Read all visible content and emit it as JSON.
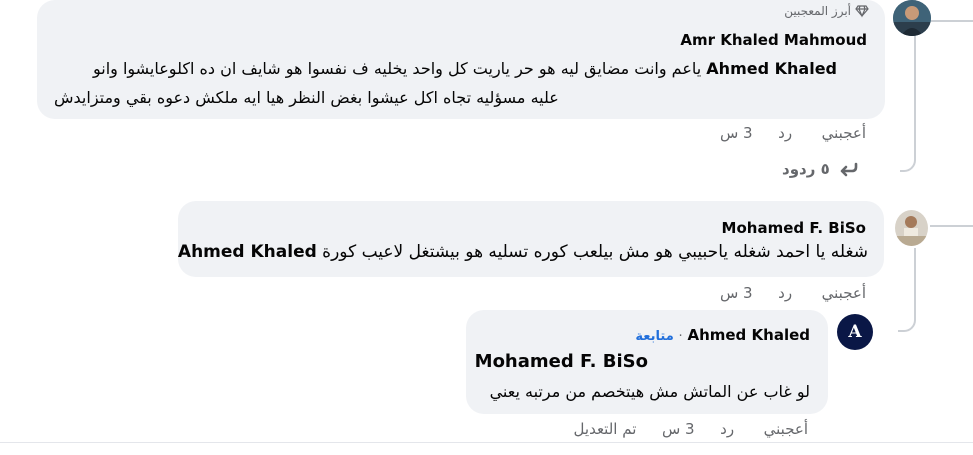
{
  "comments": [
    {
      "badge": "أبرز المعجبين",
      "author": "Amr Khaled Mahmoud",
      "mention": "Ahmed Khaled",
      "text_line1": " ياعم وانت مضايق ليه هو حر ياريت كل واحد يخليه ف نفسوا هو شايف ان ده اكلوعايشوا وانو",
      "text_line2": "عليه مسؤليه تجاه اكل عيشوا بغض النظر هيا ايه ملكش دعوه بقي ومتزايدش",
      "like": "أعجبني",
      "reply": "رد",
      "time": "3 س",
      "replies_label": "٥ ردود"
    },
    {
      "author": "Mohamed F. BiSo",
      "text": "شغله يا احمد شغله ياحبيبي هو مش بيلعب كوره تسليه هو بيشتغل لاعيب كورة ",
      "mention": "Ahmed Khaled",
      "like": "أعجبني",
      "reply": "رد",
      "time": "3 س"
    },
    {
      "author": "Ahmed Khaled",
      "follow": "متابعة",
      "separator": "·",
      "mention": "Mohamed F. BiSo",
      "text": "لو غاب عن الماتش مش هيتخصم من مرتبه يعني",
      "like": "أعجبني",
      "reply": "رد",
      "time": "3 س",
      "edited": "تم التعديل",
      "avatar_letter": "A"
    }
  ],
  "colors": {
    "bubble": "#f0f2f5",
    "meta": "#65676b",
    "link": "#216fdb",
    "line": "#ccd0d5"
  },
  "icons": [
    "diamond-icon",
    "reply-arrow-icon"
  ]
}
